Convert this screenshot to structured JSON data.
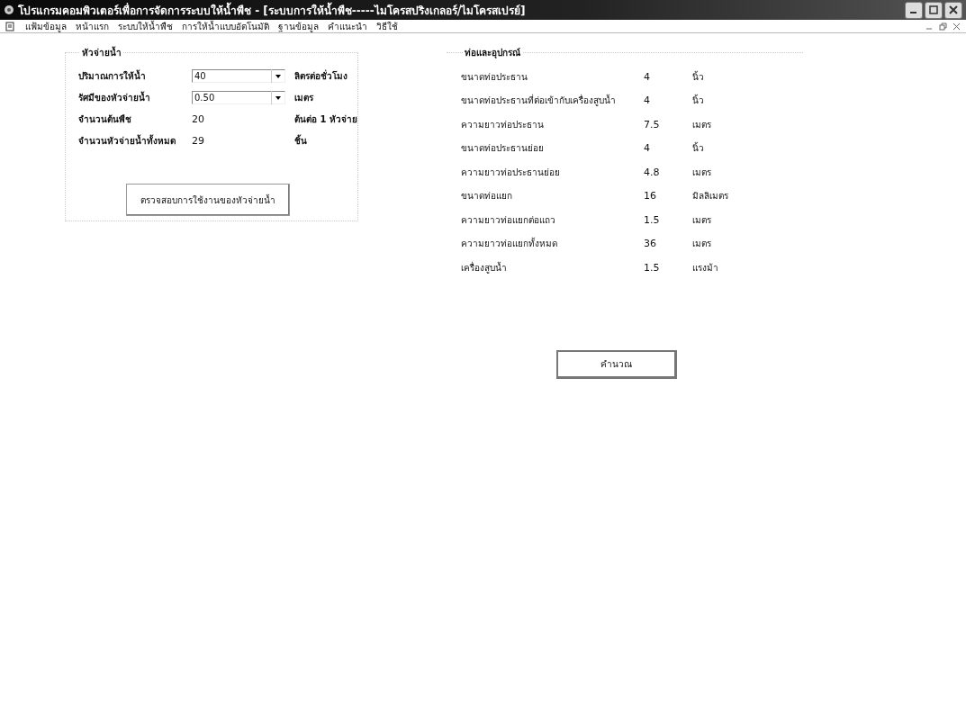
{
  "window": {
    "title": "โปรแกรมคอมพิวเตอร์เพื่อการจัดการระบบให้น้ำพืช - [ระบบการให้น้ำพืช-----ไมโครสปริงเกลอร์/ไมโครสเปรย์]"
  },
  "menu": [
    "แฟ้มข้อมูล",
    "หน้าแรก",
    "ระบบให้น้ำพืช",
    "การให้น้ำแบบอัตโนมัติ",
    "ฐานข้อมูล",
    "คำแนะนำ",
    "วิธีใช้"
  ],
  "emitter_group": {
    "title": "หัวจ่ายน้ำ",
    "rows": [
      {
        "kind": "dropdown",
        "label": "ปริมาณการให้น้ำ",
        "value": "40",
        "unit": "ลิตรต่อชั่วโมง"
      },
      {
        "kind": "dropdown",
        "label": "รัศมีของหัวจ่ายน้ำ",
        "value": "0.50",
        "unit": "เมตร"
      },
      {
        "kind": "text",
        "label": "จำนวนต้นพืช",
        "value": "20",
        "unit": "ต้นต่อ 1 หัวจ่าย"
      },
      {
        "kind": "text",
        "label": "จำนวนหัวจ่ายน้ำทั้งหมด",
        "value": "29",
        "unit": "ชิ้น"
      }
    ],
    "button": "ตรวจสอบการใช้งานของหัวจ่ายน้ำ"
  },
  "pipe_group": {
    "title": "ท่อและอุปกรณ์",
    "rows": [
      {
        "label": "ขนาดท่อประธาน",
        "value": "4",
        "unit": "นิ้ว"
      },
      {
        "label": "ขนาดท่อประธานที่ต่อเข้ากับเครื่องสูบน้ำ",
        "value": "4",
        "unit": "นิ้ว"
      },
      {
        "label": "ความยาวท่อประธาน",
        "value": "7.5",
        "unit": "เมตร"
      },
      {
        "label": "ขนาดท่อประธานย่อย",
        "value": "4",
        "unit": "นิ้ว"
      },
      {
        "label": "ความยาวท่อประธานย่อย",
        "value": "4.8",
        "unit": "เมตร"
      },
      {
        "label": "ขนาดท่อแยก",
        "value": "16",
        "unit": "มิลลิเมตร"
      },
      {
        "label": "ความยาวท่อแยกต่อแถว",
        "value": "1.5",
        "unit": "เมตร"
      },
      {
        "label": "ความยาวท่อแยกทั้งหมด",
        "value": "36",
        "unit": "เมตร"
      },
      {
        "label": "เครื่องสูบน้ำ",
        "value": "1.5",
        "unit": "แรงม้า"
      }
    ]
  },
  "calculate_button": "คำนวณ"
}
